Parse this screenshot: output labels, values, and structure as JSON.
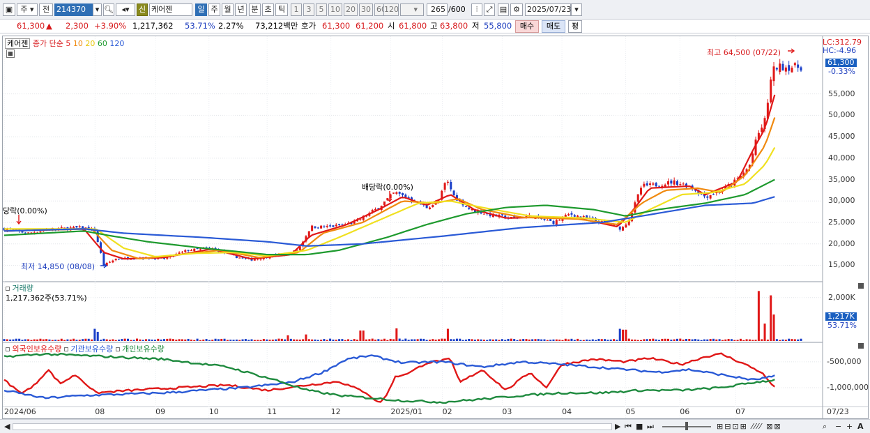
{
  "toolbar": {
    "type_select": "주",
    "prev_label": "전",
    "stock_code": "214370",
    "stock_name": "케어젠",
    "badge_new": "신",
    "periods": [
      "일",
      "주",
      "월",
      "년",
      "분",
      "초",
      "틱"
    ],
    "active_period": "일",
    "intervals": [
      "1",
      "3",
      "5",
      "10",
      "20",
      "30",
      "60",
      "120"
    ],
    "count": "265",
    "count_max": "/600",
    "date": "2025/07/23"
  },
  "quote": {
    "price": "61,300",
    "arrow": "▲",
    "change": "2,300",
    "change_pct": "+3.90%",
    "volume": "1,217,362",
    "vol_ratio": "53.71%",
    "turnover": "2.27%",
    "amount": "73,212백만",
    "bid_label": "호가",
    "ask": "61,300",
    "bid": "61,200",
    "open_label": "시",
    "open": "61,800",
    "high_label": "고",
    "high": "63,800",
    "low_label": "저",
    "low": "55,800",
    "buy_btn": "매수",
    "sell_btn": "매도",
    "eval_btn": "평"
  },
  "legend": {
    "name": "케어젠",
    "prefix": "종가 단순",
    "ma": [
      {
        "label": "5",
        "color": "#e01818"
      },
      {
        "label": "10",
        "color": "#f08a10"
      },
      {
        "label": "20",
        "color": "#e8d80a"
      },
      {
        "label": "60",
        "color": "#1e9a2e"
      },
      {
        "label": "120",
        "color": "#2a5ad6"
      }
    ]
  },
  "annotations": {
    "lc": "LC:312.79",
    "hc": "HC:-4.96",
    "high_mark": "최고 64,500 (07/22)",
    "low_mark": "최저 14,850 (08/08)",
    "dividend_left": "당락(0.00%)",
    "dividend_mid": "배당락(0.00%)",
    "current_price": "61,300",
    "current_pct": "-0.33%",
    "vol_title": "거래량",
    "vol_value": "1,217,362주(53.71%)",
    "vol_current": "1,217K",
    "vol_pct": "53.71%",
    "inv_titles": [
      "외국인보유수량",
      "기관보유수량",
      "개인보유수량"
    ],
    "inv_colors": [
      "#e01818",
      "#2a5ad6",
      "#1e8a3e"
    ]
  },
  "chart_data": {
    "type": "candlestick",
    "price_axis": [
      "55,000",
      "50,000",
      "45,000",
      "40,000",
      "35,000",
      "30,000",
      "25,000",
      "20,000",
      "15,000"
    ],
    "price_ticks": [
      55000,
      50000,
      45000,
      40000,
      35000,
      30000,
      25000,
      20000,
      15000
    ],
    "volume_axis": [
      "2,000K"
    ],
    "volume_ticks": [
      2000
    ],
    "investor_axis": [
      "-500,000",
      "-1,000,000"
    ],
    "investor_ticks": [
      -500000,
      -1000000
    ],
    "x_labels": [
      "2024/06",
      "08",
      "09",
      "10",
      "11",
      "12",
      "2025/01",
      "02",
      "03",
      "04",
      "05",
      "06",
      "07",
      "07/23"
    ],
    "x_fracs": [
      0,
      0.114,
      0.19,
      0.257,
      0.33,
      0.41,
      0.485,
      0.55,
      0.625,
      0.7,
      0.78,
      0.848,
      0.918,
      1.0
    ],
    "close_keypoints": [
      [
        0,
        23500
      ],
      [
        0.03,
        22500
      ],
      [
        0.06,
        23500
      ],
      [
        0.1,
        23800
      ],
      [
        0.114,
        23000
      ],
      [
        0.125,
        15000
      ],
      [
        0.14,
        16500
      ],
      [
        0.17,
        16800
      ],
      [
        0.2,
        16500
      ],
      [
        0.23,
        18500
      ],
      [
        0.26,
        19000
      ],
      [
        0.29,
        17000
      ],
      [
        0.31,
        16300
      ],
      [
        0.33,
        17000
      ],
      [
        0.36,
        17800
      ],
      [
        0.37,
        19000
      ],
      [
        0.385,
        24000
      ],
      [
        0.41,
        24000
      ],
      [
        0.44,
        25000
      ],
      [
        0.47,
        28500
      ],
      [
        0.49,
        32000
      ],
      [
        0.51,
        30500
      ],
      [
        0.53,
        28500
      ],
      [
        0.545,
        29800
      ],
      [
        0.555,
        35000
      ],
      [
        0.565,
        31000
      ],
      [
        0.585,
        28000
      ],
      [
        0.61,
        26800
      ],
      [
        0.635,
        26000
      ],
      [
        0.66,
        26500
      ],
      [
        0.69,
        25000
      ],
      [
        0.71,
        27000
      ],
      [
        0.74,
        25500
      ],
      [
        0.76,
        24500
      ],
      [
        0.775,
        23500
      ],
      [
        0.785,
        26000
      ],
      [
        0.8,
        33500
      ],
      [
        0.82,
        33800
      ],
      [
        0.84,
        34500
      ],
      [
        0.86,
        33500
      ],
      [
        0.88,
        31000
      ],
      [
        0.9,
        32500
      ],
      [
        0.92,
        35000
      ],
      [
        0.935,
        38000
      ],
      [
        0.945,
        45000
      ],
      [
        0.955,
        49000
      ],
      [
        0.962,
        58000
      ],
      [
        0.967,
        61300
      ]
    ],
    "ma_keypoints": {
      "5": [
        [
          0,
          23000
        ],
        [
          0.1,
          23500
        ],
        [
          0.125,
          18000
        ],
        [
          0.15,
          16500
        ],
        [
          0.2,
          16800
        ],
        [
          0.26,
          18800
        ],
        [
          0.31,
          16500
        ],
        [
          0.36,
          17500
        ],
        [
          0.385,
          22000
        ],
        [
          0.43,
          24500
        ],
        [
          0.47,
          28000
        ],
        [
          0.5,
          31000
        ],
        [
          0.53,
          29000
        ],
        [
          0.56,
          31500
        ],
        [
          0.59,
          28000
        ],
        [
          0.63,
          26000
        ],
        [
          0.67,
          26200
        ],
        [
          0.72,
          26000
        ],
        [
          0.77,
          24000
        ],
        [
          0.79,
          28000
        ],
        [
          0.81,
          33000
        ],
        [
          0.86,
          33500
        ],
        [
          0.88,
          31500
        ],
        [
          0.92,
          34500
        ],
        [
          0.94,
          42000
        ],
        [
          0.955,
          47000
        ],
        [
          0.967,
          54800
        ]
      ],
      "10": [
        [
          0,
          23000
        ],
        [
          0.11,
          23500
        ],
        [
          0.135,
          18500
        ],
        [
          0.17,
          16500
        ],
        [
          0.22,
          17500
        ],
        [
          0.27,
          18500
        ],
        [
          0.32,
          16800
        ],
        [
          0.37,
          18000
        ],
        [
          0.4,
          22500
        ],
        [
          0.45,
          25000
        ],
        [
          0.5,
          30000
        ],
        [
          0.54,
          29500
        ],
        [
          0.57,
          30500
        ],
        [
          0.6,
          28000
        ],
        [
          0.65,
          26200
        ],
        [
          0.72,
          25800
        ],
        [
          0.77,
          24500
        ],
        [
          0.8,
          29500
        ],
        [
          0.83,
          32500
        ],
        [
          0.87,
          33000
        ],
        [
          0.9,
          32000
        ],
        [
          0.93,
          36000
        ],
        [
          0.955,
          43000
        ],
        [
          0.967,
          49500
        ]
      ],
      "20": [
        [
          0,
          23500
        ],
        [
          0.115,
          23500
        ],
        [
          0.15,
          19000
        ],
        [
          0.19,
          17000
        ],
        [
          0.24,
          17800
        ],
        [
          0.29,
          18000
        ],
        [
          0.33,
          17200
        ],
        [
          0.38,
          18500
        ],
        [
          0.42,
          21500
        ],
        [
          0.47,
          25500
        ],
        [
          0.52,
          29500
        ],
        [
          0.56,
          30000
        ],
        [
          0.6,
          28500
        ],
        [
          0.66,
          26500
        ],
        [
          0.73,
          26000
        ],
        [
          0.78,
          25000
        ],
        [
          0.81,
          28000
        ],
        [
          0.85,
          31500
        ],
        [
          0.89,
          32000
        ],
        [
          0.93,
          34000
        ],
        [
          0.955,
          38500
        ],
        [
          0.967,
          42500
        ]
      ],
      "60": [
        [
          0,
          22000
        ],
        [
          0.1,
          23000
        ],
        [
          0.13,
          22000
        ],
        [
          0.18,
          20500
        ],
        [
          0.25,
          19000
        ],
        [
          0.33,
          17500
        ],
        [
          0.38,
          17500
        ],
        [
          0.42,
          18500
        ],
        [
          0.48,
          21500
        ],
        [
          0.53,
          24500
        ],
        [
          0.58,
          27000
        ],
        [
          0.63,
          28500
        ],
        [
          0.68,
          29000
        ],
        [
          0.74,
          28000
        ],
        [
          0.78,
          26500
        ],
        [
          0.82,
          28000
        ],
        [
          0.88,
          29500
        ],
        [
          0.93,
          31500
        ],
        [
          0.967,
          35000
        ]
      ],
      "120": [
        [
          0,
          23000
        ],
        [
          0.1,
          23500
        ],
        [
          0.15,
          22500
        ],
        [
          0.25,
          21500
        ],
        [
          0.33,
          20500
        ],
        [
          0.38,
          19500
        ],
        [
          0.45,
          20000
        ],
        [
          0.55,
          21800
        ],
        [
          0.65,
          23800
        ],
        [
          0.75,
          25000
        ],
        [
          0.8,
          26500
        ],
        [
          0.88,
          29000
        ],
        [
          0.94,
          29500
        ],
        [
          0.967,
          31000
        ]
      ]
    },
    "volume_spikes": [
      [
        0.113,
        560
      ],
      [
        0.118,
        420
      ],
      [
        0.357,
        260
      ],
      [
        0.38,
        300
      ],
      [
        0.449,
        480
      ],
      [
        0.493,
        580
      ],
      [
        0.558,
        560
      ],
      [
        0.775,
        560
      ],
      [
        0.779,
        520
      ],
      [
        0.948,
        2300
      ],
      [
        0.955,
        800
      ],
      [
        0.962,
        2100
      ],
      [
        0.967,
        1217
      ]
    ],
    "investor_keypoints": {
      "foreign": [
        [
          0,
          -850000
        ],
        [
          0.02,
          -1100000
        ],
        [
          0.035,
          -1000000
        ],
        [
          0.055,
          -650000
        ],
        [
          0.07,
          -920000
        ],
        [
          0.09,
          -750000
        ],
        [
          0.115,
          -1100000
        ],
        [
          0.16,
          -1050000
        ],
        [
          0.22,
          -1000000
        ],
        [
          0.28,
          -950000
        ],
        [
          0.33,
          -1050000
        ],
        [
          0.38,
          -950000
        ],
        [
          0.42,
          -880000
        ],
        [
          0.455,
          -1100000
        ],
        [
          0.47,
          -1300000
        ],
        [
          0.48,
          -1150000
        ],
        [
          0.49,
          -800000
        ],
        [
          0.51,
          -700000
        ],
        [
          0.53,
          -520000
        ],
        [
          0.56,
          -450000
        ],
        [
          0.572,
          -900000
        ],
        [
          0.6,
          -650000
        ],
        [
          0.63,
          -1050000
        ],
        [
          0.66,
          -700000
        ],
        [
          0.68,
          -1000000
        ],
        [
          0.7,
          -550000
        ],
        [
          0.74,
          -450000
        ],
        [
          0.78,
          -500000
        ],
        [
          0.81,
          -430000
        ],
        [
          0.85,
          -550000
        ],
        [
          0.88,
          -400000
        ],
        [
          0.9,
          -350000
        ],
        [
          0.93,
          -550000
        ],
        [
          0.95,
          -700000
        ],
        [
          0.967,
          -1000000
        ]
      ],
      "institution": [
        [
          0,
          -1050000
        ],
        [
          0.05,
          -1200000
        ],
        [
          0.1,
          -1150000
        ],
        [
          0.2,
          -1100000
        ],
        [
          0.3,
          -1000000
        ],
        [
          0.36,
          -900000
        ],
        [
          0.4,
          -700000
        ],
        [
          0.43,
          -450000
        ],
        [
          0.46,
          -380000
        ],
        [
          0.5,
          -520000
        ],
        [
          0.55,
          -500000
        ],
        [
          0.6,
          -600000
        ],
        [
          0.65,
          -500000
        ],
        [
          0.7,
          -550000
        ],
        [
          0.74,
          -600000
        ],
        [
          0.78,
          -650000
        ],
        [
          0.82,
          -700000
        ],
        [
          0.86,
          -650000
        ],
        [
          0.9,
          -750000
        ],
        [
          0.94,
          -850000
        ],
        [
          0.967,
          -780000
        ]
      ],
      "individual": [
        [
          0,
          -400000
        ],
        [
          0.05,
          -350000
        ],
        [
          0.1,
          -380000
        ],
        [
          0.2,
          -450000
        ],
        [
          0.28,
          -600000
        ],
        [
          0.34,
          -850000
        ],
        [
          0.38,
          -1050000
        ],
        [
          0.42,
          -1150000
        ],
        [
          0.46,
          -1200000
        ],
        [
          0.5,
          -1250000
        ],
        [
          0.55,
          -1280000
        ],
        [
          0.6,
          -1220000
        ],
        [
          0.65,
          -1150000
        ],
        [
          0.7,
          -1100000
        ],
        [
          0.75,
          -1100000
        ],
        [
          0.8,
          -1050000
        ],
        [
          0.85,
          -1050000
        ],
        [
          0.9,
          -1000000
        ],
        [
          0.94,
          -900000
        ],
        [
          0.967,
          -850000
        ]
      ]
    }
  },
  "bottom": {
    "scroll_left": "◀",
    "nav": [
      "▶",
      "⏮",
      "■",
      "⏭"
    ],
    "zoom": [
      "−",
      "+",
      "A"
    ]
  }
}
